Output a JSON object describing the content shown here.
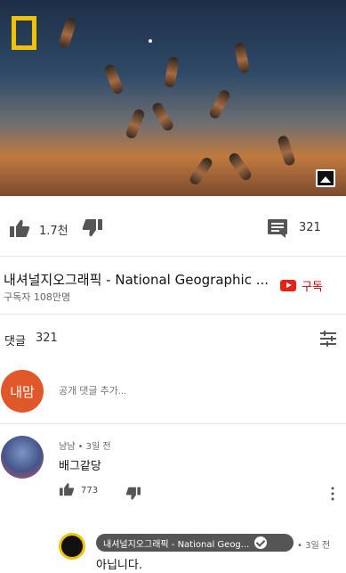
{
  "video": {
    "likes": "1.7천",
    "comment_count": "321"
  },
  "channel": {
    "name": "내셔널지오그래픽 - National Geographic ...",
    "subscribers": "구독자 108만명",
    "subscribe_label": "구독"
  },
  "comments": {
    "title": "댓글",
    "count": "321",
    "my_avatar_text": "내맘",
    "input_placeholder": "공개 댓글 추가...",
    "items": [
      {
        "author_time": "냠냠 • 3일 전",
        "text": "배그같당",
        "likes": "773"
      }
    ],
    "reply": {
      "author": "내셔널지오그래픽 - National Geog...",
      "time": "• 3일 전",
      "text": "아닙니다."
    }
  },
  "icons": {
    "like": "like-icon",
    "dislike": "dislike-icon",
    "comment": "comment-icon",
    "sort": "sort-icon",
    "image": "image-icon",
    "youtube": "youtube-icon",
    "verified": "verified-icon",
    "menu": "more-vert-icon"
  },
  "colors": {
    "subscribe": "#cc0000",
    "my_avatar": "#e0582a",
    "natgeo_yellow": "#f2c200"
  }
}
